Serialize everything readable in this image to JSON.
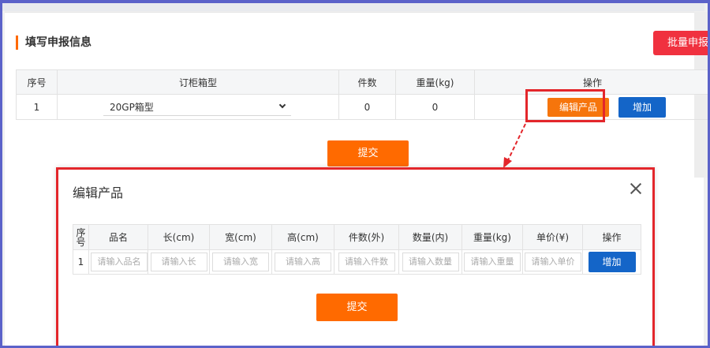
{
  "section": {
    "title": "填写申报信息",
    "bulk_label": "批量申报"
  },
  "main_table": {
    "headers": [
      "序号",
      "订柜箱型",
      "件数",
      "重量(kg)",
      "操作"
    ],
    "row": {
      "seq": "1",
      "container_type": "20GP箱型",
      "pieces": "0",
      "weight": "0"
    },
    "edit_label": "编辑产品",
    "add_label": "增加"
  },
  "submit_label": "提交",
  "dialog": {
    "title": "编辑产品",
    "headers": [
      "序号",
      "品名",
      "长(cm)",
      "宽(cm)",
      "高(cm)",
      "件数(外)",
      "数量(内)",
      "重量(kg)",
      "单价(¥)",
      "操作"
    ],
    "row_seq": "1",
    "placeholders": [
      "请输入品名",
      "请输入长",
      "请输入宽",
      "请输入高",
      "请输入件数",
      "请输入数量",
      "请输入重量",
      "请输入单价"
    ],
    "add_label": "增加",
    "submit_label": "提交"
  },
  "colors": {
    "accent": "#ff6a00",
    "primary": "#1465c8",
    "danger": "#f0313f",
    "highlight": "#e3262b"
  },
  "icons": {
    "close": "close-icon",
    "dropdown": "chevron-down-icon"
  }
}
